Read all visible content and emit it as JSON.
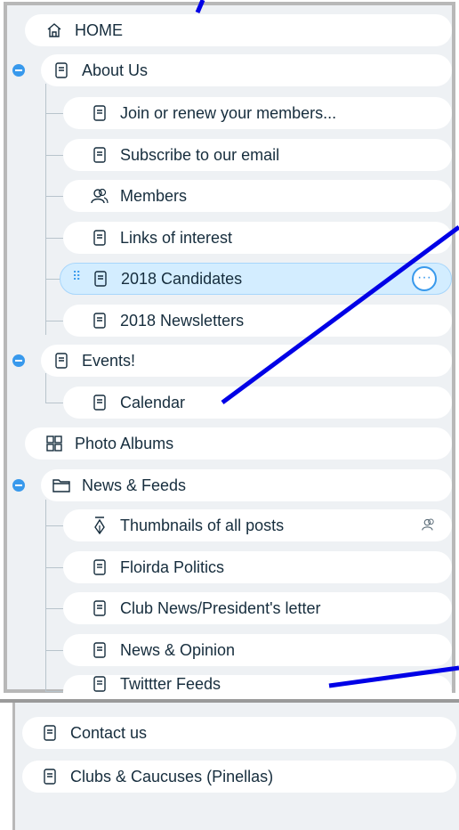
{
  "menu": {
    "home": "HOME",
    "about_us": "About Us",
    "about_children": [
      "Join or renew your members...",
      "Subscribe to our email",
      "Members",
      "Links of interest",
      "2018 Candidates",
      "2018 Newsletters"
    ],
    "events": "Events!",
    "events_children": [
      "Calendar"
    ],
    "photo_albums": "Photo Albums",
    "news_feeds": "News & Feeds",
    "news_children": [
      "Thumbnails of all posts",
      "Floirda Politics",
      "Club News/President's letter",
      "News & Opinion",
      "Twittter Feeds"
    ]
  },
  "lower_menu": {
    "items": [
      "Contact us",
      "Clubs & Caucuses (Pinellas)"
    ]
  },
  "colors": {
    "accent": "#3899ec",
    "selected_bg": "#d3edff",
    "text": "#162d3d",
    "annotation_arrow": "#0000e6"
  },
  "icons": {
    "home": "home-icon",
    "page": "page-icon",
    "members": "members-icon",
    "photo_albums": "gallery-icon",
    "folder": "folder-icon",
    "thumbnails": "pen-icon",
    "restricted": "members-only-icon",
    "more": "more-actions-icon"
  },
  "more_glyph": "···",
  "drag_glyph": "⠿"
}
